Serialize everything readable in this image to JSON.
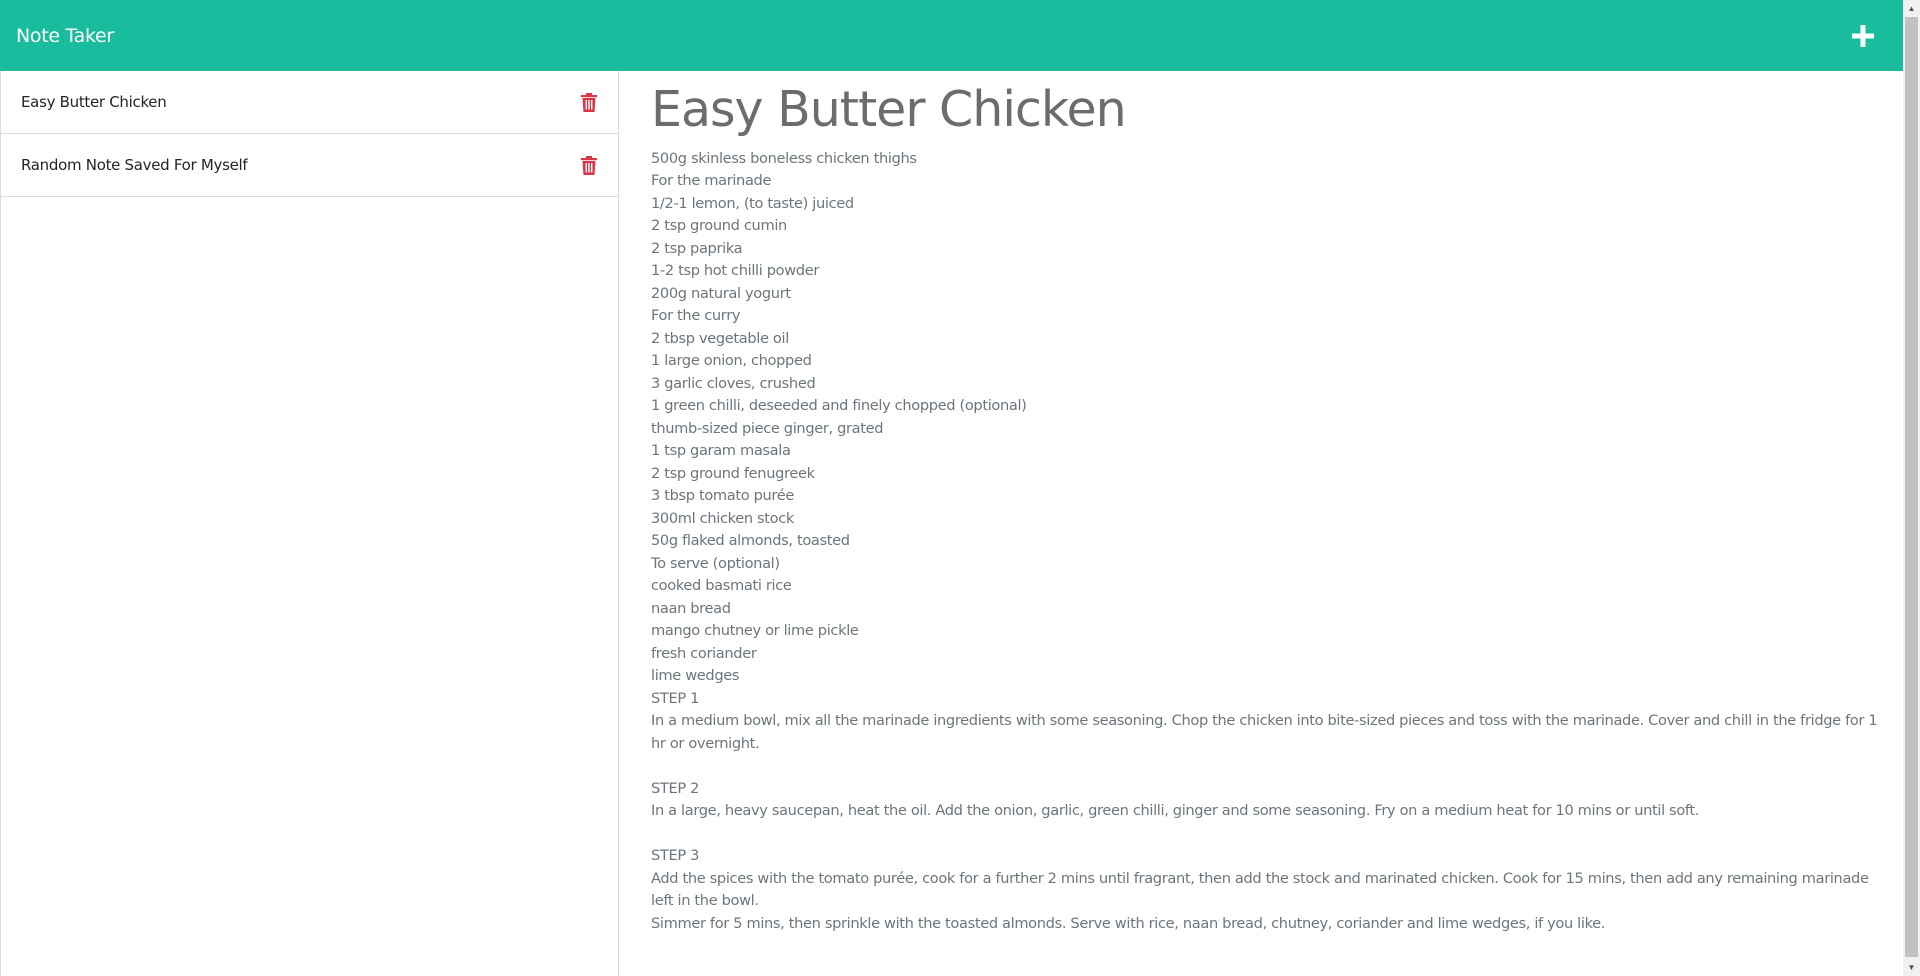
{
  "navbar": {
    "brand": "Note Taker",
    "new_note_icon": "plus-icon"
  },
  "sidebar": {
    "notes": [
      {
        "title": "Easy Butter Chicken",
        "delete_icon": "trash-icon"
      },
      {
        "title": "Random Note Saved For Myself",
        "delete_icon": "trash-icon"
      }
    ]
  },
  "active_note": {
    "title": "Easy Butter Chicken",
    "text": "500g skinless boneless chicken thighs\nFor the marinade\n1/2-1 lemon, (to taste) juiced\n2 tsp ground cumin\n2 tsp paprika\n1-2 tsp hot chilli powder\n200g natural yogurt\nFor the curry\n2 tbsp vegetable oil\n1 large onion, chopped\n3 garlic cloves, crushed\n1 green chilli, deseeded and finely chopped (optional)\nthumb-sized piece ginger, grated\n1 tsp garam masala\n2 tsp ground fenugreek\n3 tbsp tomato purée\n300ml chicken stock\n50g flaked almonds, toasted\nTo serve (optional)\ncooked basmati rice\nnaan bread\nmango chutney or lime pickle\nfresh coriander\nlime wedges\nSTEP 1\nIn a medium bowl, mix all the marinade ingredients with some seasoning. Chop the chicken into bite-sized pieces and toss with the marinade. Cover and chill in the fridge for 1 hr or overnight.\n\nSTEP 2\nIn a large, heavy saucepan, heat the oil. Add the onion, garlic, green chilli, ginger and some seasoning. Fry on a medium heat for 10 mins or until soft.\n\nSTEP 3\nAdd the spices with the tomato purée, cook for a further 2 mins until fragrant, then add the stock and marinated chicken. Cook for 15 mins, then add any remaining marinade left in the bowl.\nSimmer for 5 mins, then sprinkle with the toasted almonds. Serve with rice, naan bread, chutney, coriander and lime wedges, if you like."
  },
  "colors": {
    "navbar": "#19bc9c",
    "delete": "#dc3545",
    "heading": "#6c6c6c",
    "body_text": "#6c757d"
  }
}
